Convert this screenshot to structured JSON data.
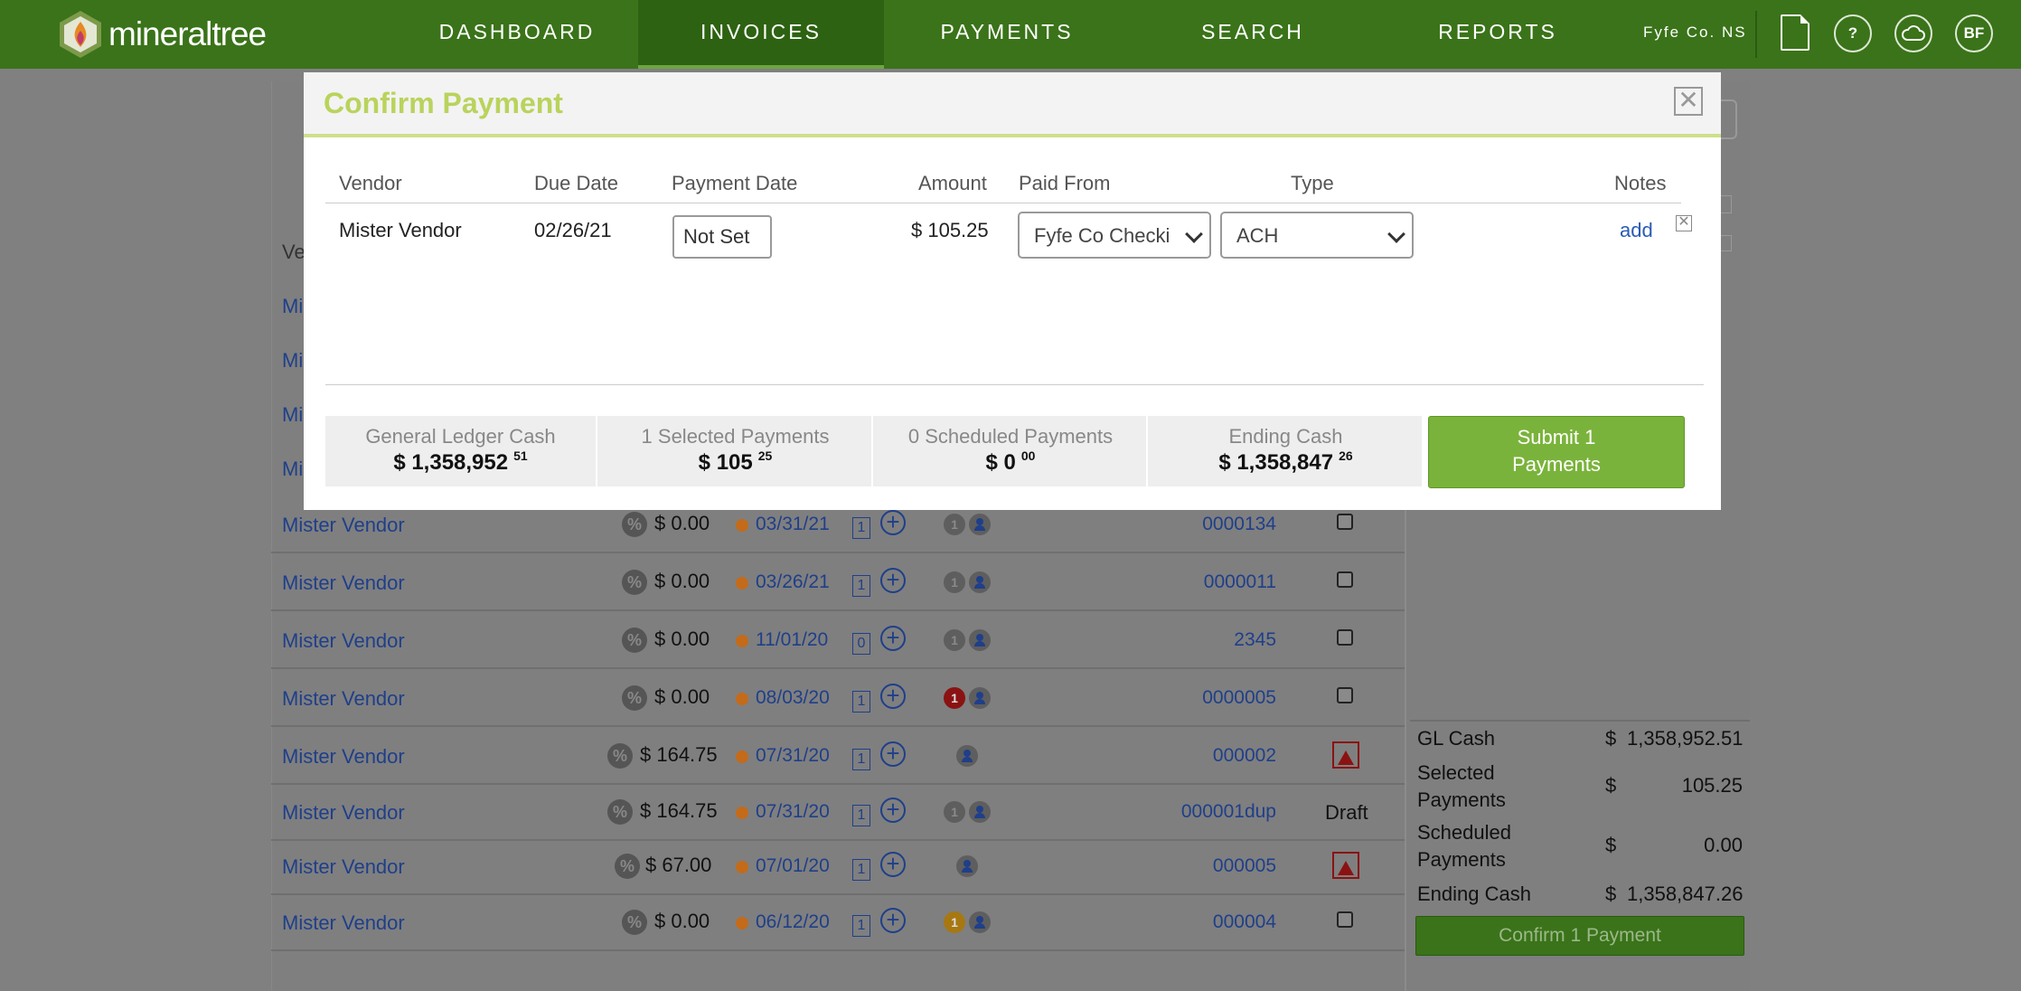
{
  "nav": {
    "logo_text": "mineraltree",
    "items": [
      "DASHBOARD",
      "INVOICES",
      "PAYMENTS",
      "SEARCH",
      "REPORTS"
    ],
    "active": "INVOICES",
    "org": "Fyfe Co. NS",
    "avatar": "BF",
    "help_glyph": "?"
  },
  "page": {
    "vendor_header_stub": "Ve",
    "vendor_stub": "Mi",
    "rows": [
      {
        "vendor": "Mister Vendor",
        "amount": "$ 0.00",
        "date": "03/31/21",
        "count": "1",
        "badge": "1",
        "invoice": "0000134",
        "status": "checkbox"
      },
      {
        "vendor": "Mister Vendor",
        "amount": "$ 0.00",
        "date": "03/26/21",
        "count": "1",
        "badge": "1",
        "invoice": "0000011",
        "status": "checkbox"
      },
      {
        "vendor": "Mister Vendor",
        "amount": "$ 0.00",
        "date": "11/01/20",
        "count": "0",
        "badge": "1",
        "invoice": "2345",
        "status": "checkbox"
      },
      {
        "vendor": "Mister Vendor",
        "amount": "$ 0.00",
        "date": "08/03/20",
        "count": "1",
        "badge": "1",
        "invoice": "0000005",
        "status": "checkbox"
      },
      {
        "vendor": "Mister Vendor",
        "amount": "$ 164.75",
        "date": "07/31/20",
        "count": "1",
        "badge": "",
        "invoice": "000002",
        "status": "pdf"
      },
      {
        "vendor": "Mister Vendor",
        "amount": "$ 164.75",
        "date": "07/31/20",
        "count": "1",
        "badge": "1",
        "invoice": "000001dup",
        "status": "Draft"
      },
      {
        "vendor": "Mister Vendor",
        "amount": "$ 67.00",
        "date": "07/01/20",
        "count": "1",
        "badge": "",
        "invoice": "000005",
        "status": "pdf"
      },
      {
        "vendor": "Mister Vendor",
        "amount": "$ 0.00",
        "date": "06/12/20",
        "count": "1",
        "badge": "1",
        "invoice": "000004",
        "status": "checkbox"
      }
    ],
    "pct_glyph": "%",
    "plus_glyph": "+"
  },
  "totals": {
    "gl_cash_label": "GL Cash",
    "gl_cash_currency": "$",
    "gl_cash_value": "1,358,952.51",
    "selected_label_1": "Selected",
    "selected_label_2": "Payments",
    "selected_currency": "$",
    "selected_value": "105.25",
    "scheduled_label_1": "Scheduled",
    "scheduled_label_2": "Payments",
    "scheduled_currency": "$",
    "scheduled_value": "0.00",
    "ending_label": "Ending Cash",
    "ending_currency": "$",
    "ending_value": "1,358,847.26",
    "confirm_button": "Confirm 1 Payment"
  },
  "modal": {
    "title": "Confirm Payment",
    "close_glyph": "✕",
    "headers": {
      "vendor": "Vendor",
      "due_date": "Due Date",
      "payment_date": "Payment Date",
      "amount": "Amount",
      "paid_from": "Paid From",
      "type": "Type",
      "notes": "Notes"
    },
    "row": {
      "vendor": "Mister Vendor",
      "due_date": "02/26/21",
      "payment_date": "Not Set",
      "amount": "$ 105.25",
      "paid_from": "Fyfe Co Checking",
      "type": "ACH",
      "notes_link": "add",
      "remove_glyph": "✕"
    },
    "summary": {
      "gl_label": "General Ledger Cash",
      "gl_value": "$ 1,358,952",
      "gl_cents": "51",
      "selected_label": "1 Selected Payments",
      "selected_value": "$ 105",
      "selected_cents": "25",
      "scheduled_label": "0 Scheduled Payments",
      "scheduled_value": "$ 0",
      "scheduled_cents": "00",
      "ending_label": "Ending Cash",
      "ending_value": "$ 1,358,847",
      "ending_cents": "26"
    },
    "submit_line1": "Submit 1",
    "submit_line2": "Payments"
  },
  "colors": {
    "nav_green": "#3a7319",
    "title_green": "#b9d35c",
    "submit_green": "#7ab33b",
    "link_blue": "#2a5bb5"
  }
}
